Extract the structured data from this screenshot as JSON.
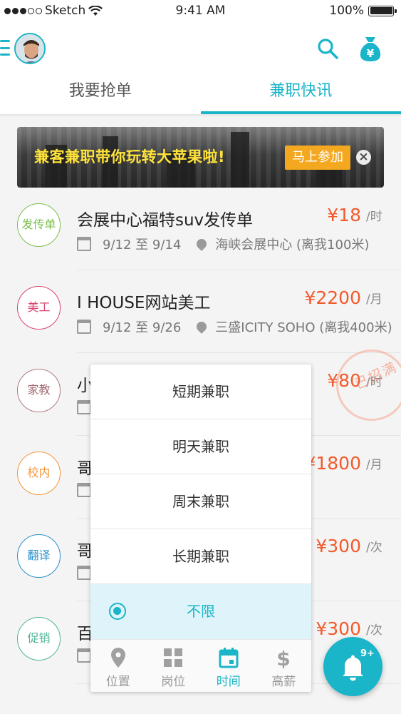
{
  "status_bar": {
    "carrier": "Sketch",
    "time": "9:41 AM",
    "battery": "100%"
  },
  "header": {
    "tabs": [
      {
        "label": "我要抢单",
        "active": false
      },
      {
        "label": "兼职快讯",
        "active": true
      }
    ]
  },
  "banner": {
    "text": "兼客兼职带你玩转大苹果啦!",
    "button_label": "马上参加",
    "close_glyph": "×"
  },
  "jobs": [
    {
      "badge": "发传单",
      "badge_color": "#7cbf4e",
      "title": "会展中心福特suv发传单",
      "date": "9/12 至 9/14",
      "location": "海峡会展中心 (离我100米)",
      "price": "¥18",
      "unit": "/时"
    },
    {
      "badge": "美工",
      "badge_color": "#d9466e",
      "title": "I HOUSE网站美工",
      "date": "9/12 至 9/26",
      "location": "三盛ICITY SOHO (离我400米)",
      "price": "¥2200",
      "unit": "/月"
    },
    {
      "badge": "家教",
      "badge_color": "#b3797f",
      "title": "小",
      "date": "",
      "location": "",
      "price": "¥80",
      "unit": "/时"
    },
    {
      "badge": "校内",
      "badge_color": "#f5953b",
      "title": "哥",
      "date": "",
      "location": "",
      "price": "¥1800",
      "unit": "/月"
    },
    {
      "badge": "翻译",
      "badge_color": "#2a8fc9",
      "title": "哥",
      "date": "",
      "location": "",
      "price": "¥300",
      "unit": "/次"
    },
    {
      "badge": "促销",
      "badge_color": "#4fb596",
      "title": "百",
      "date": "",
      "location": "",
      "price": "¥300",
      "unit": "/次"
    }
  ],
  "stamp": "已招满",
  "dropdown": {
    "options": [
      {
        "label": "短期兼职",
        "selected": false
      },
      {
        "label": "明天兼职",
        "selected": false
      },
      {
        "label": "周末兼职",
        "selected": false
      },
      {
        "label": "长期兼职",
        "selected": false
      },
      {
        "label": "不限",
        "selected": true
      }
    ]
  },
  "filter_bar": {
    "tabs": [
      {
        "label": "位置",
        "icon": "location-pin-icon",
        "active": false
      },
      {
        "label": "岗位",
        "icon": "grid-icon",
        "active": false
      },
      {
        "label": "时间",
        "icon": "calendar-icon",
        "active": true
      },
      {
        "label": "高薪",
        "icon": "dollar-icon",
        "active": false
      }
    ]
  },
  "notification_fab": {
    "count": "9+"
  },
  "colors": {
    "accent": "#1ab5c8",
    "price": "#f35a2b",
    "banner_text": "#ffe33a",
    "banner_button": "#f4a820"
  }
}
